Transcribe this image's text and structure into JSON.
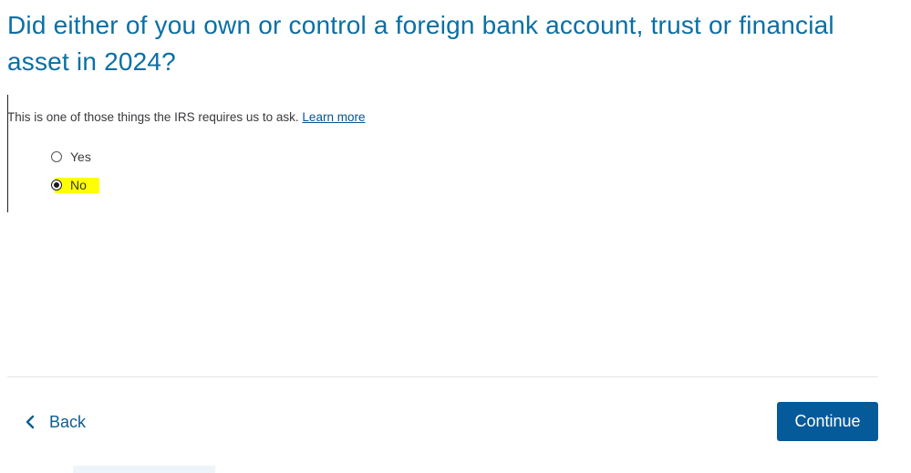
{
  "question": {
    "title": "Did either of you own or control a foreign bank account, trust or financial asset in 2024?"
  },
  "helper": {
    "text": "This is one of those things the IRS requires us to ask. ",
    "link_label": "Learn more"
  },
  "options": {
    "yes_label": "Yes",
    "no_label": "No",
    "selected": "No"
  },
  "footer": {
    "back_label": "Back",
    "continue_label": "Continue"
  },
  "colors": {
    "title": "#0b6fa4",
    "link": "#055393",
    "primary_button": "#055a9a",
    "highlight": "#ffff00"
  },
  "icons": {
    "back": "chevron-left-icon"
  }
}
